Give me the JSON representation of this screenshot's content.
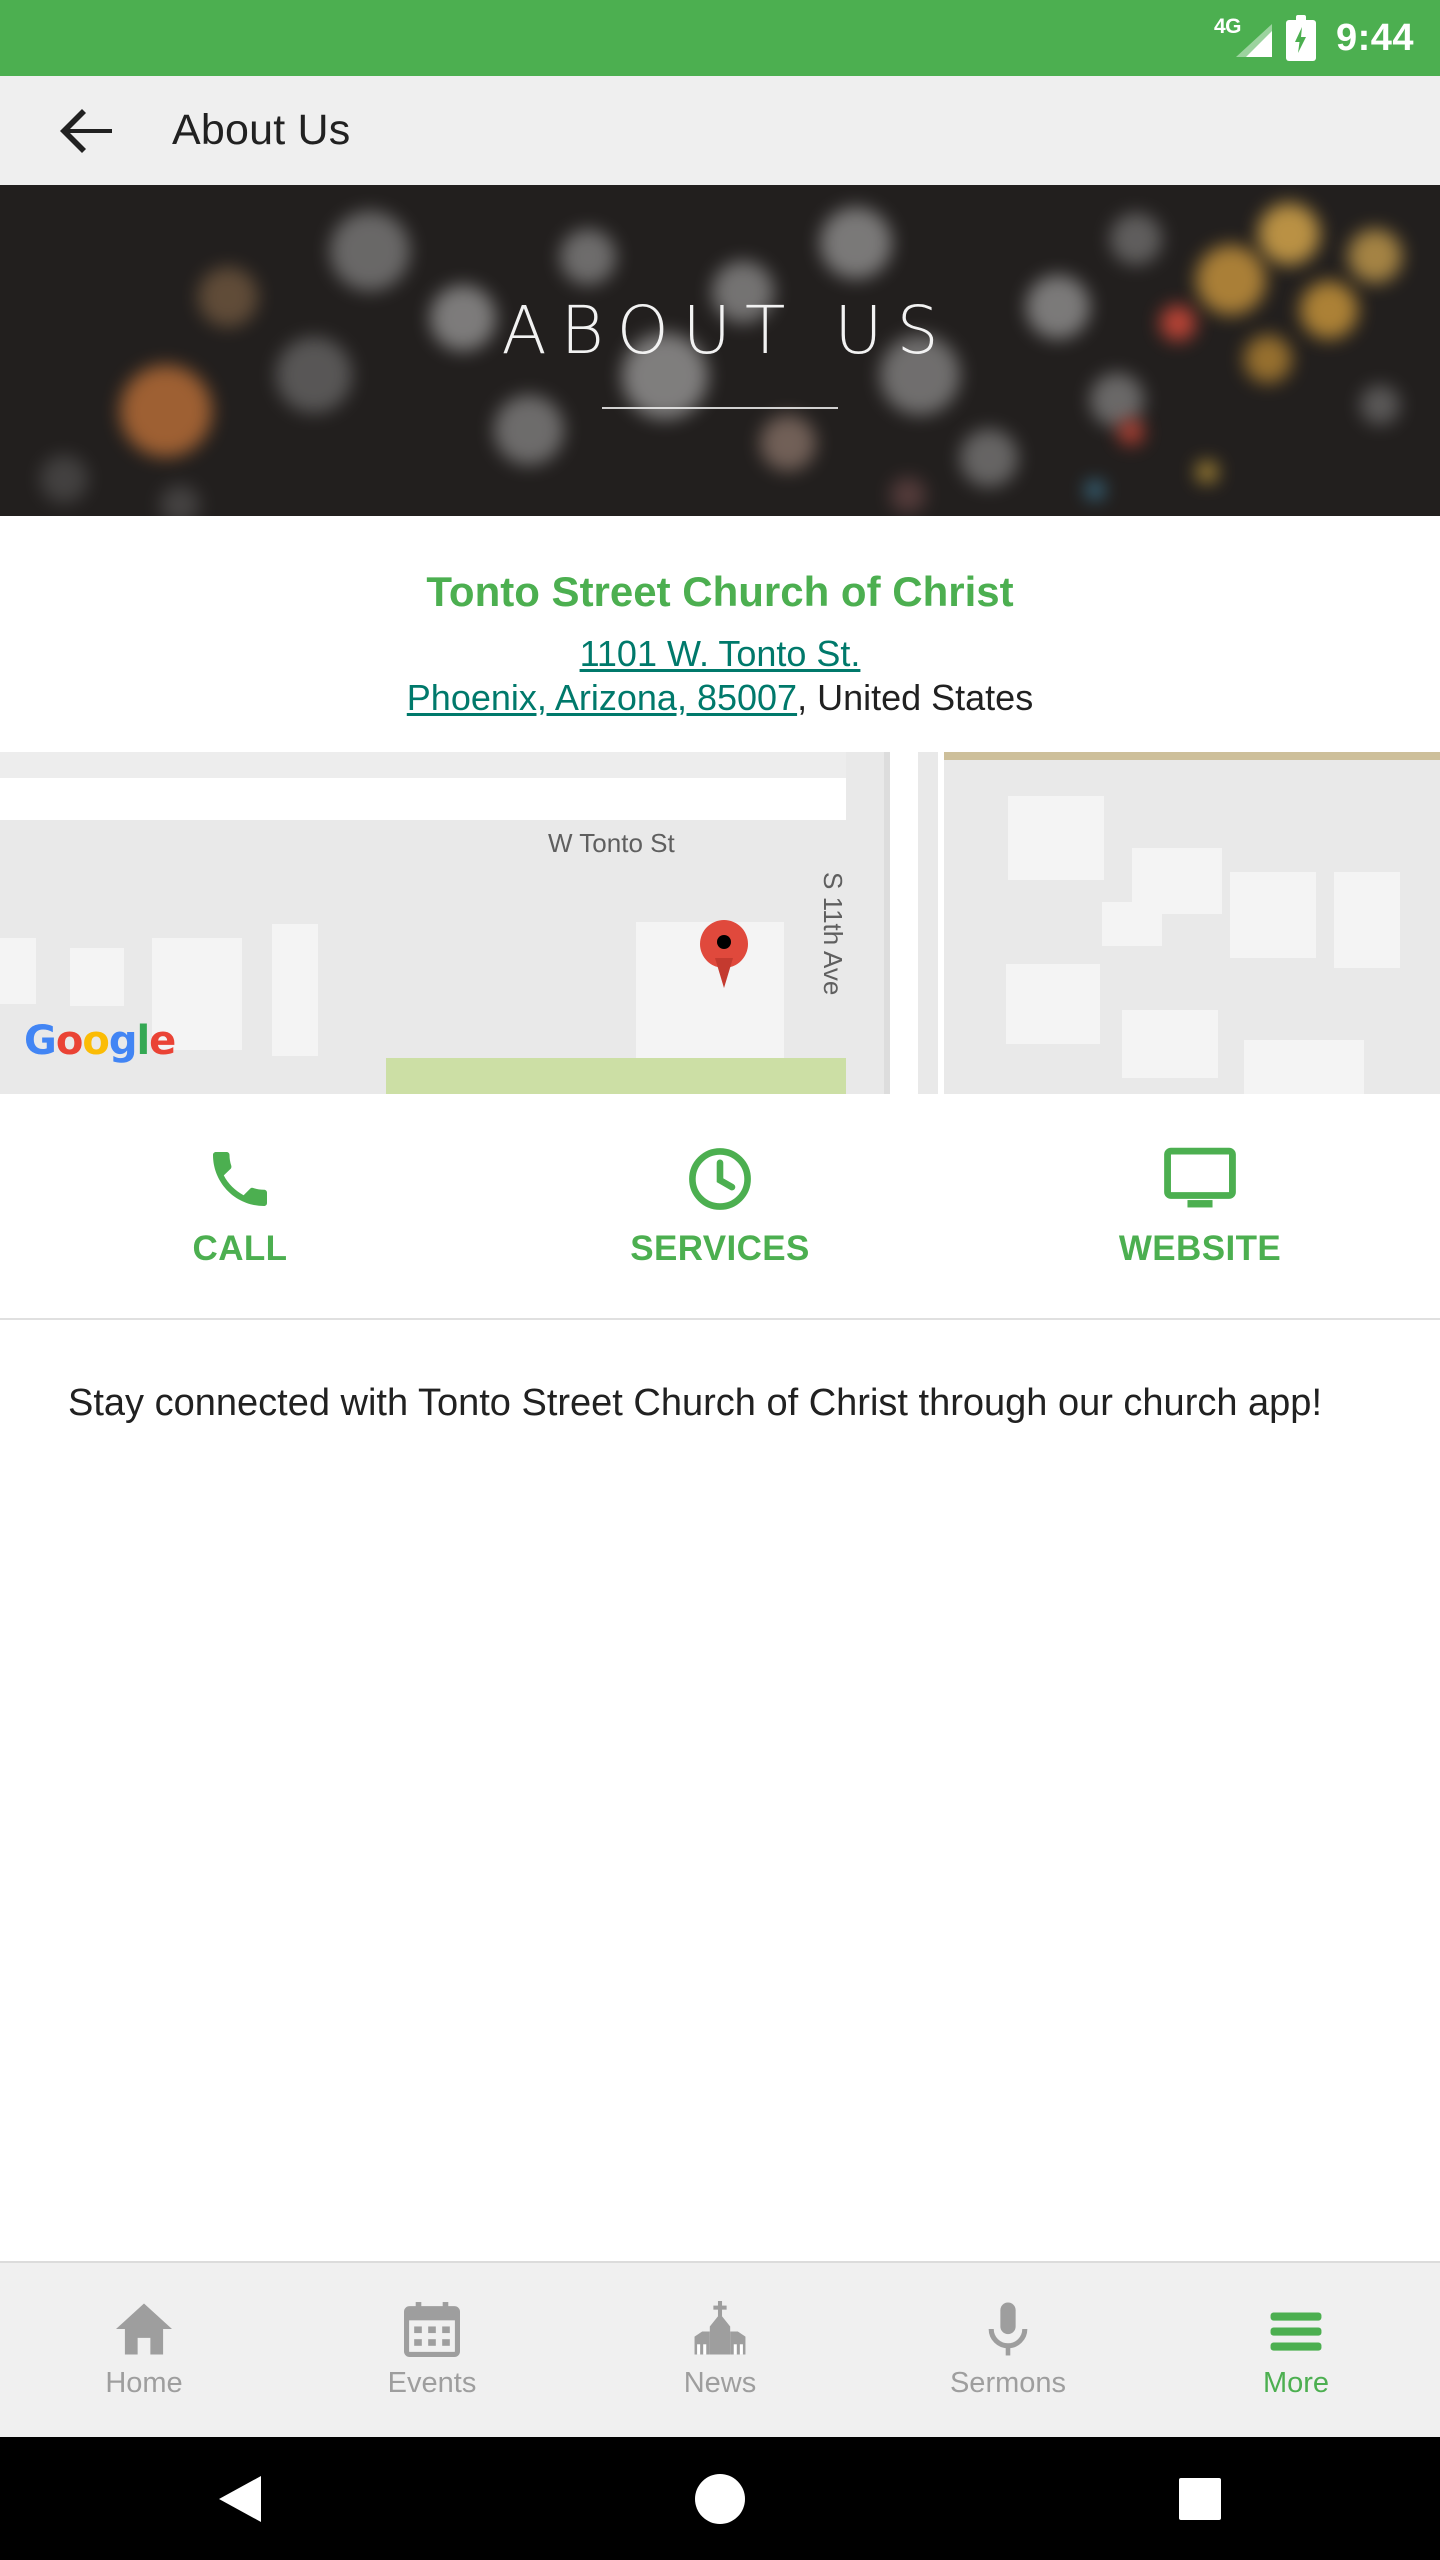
{
  "status_bar": {
    "network": "4G",
    "time": "9:44",
    "signal_icon": "signal-bars-icon",
    "battery_icon": "battery-charging-icon",
    "bg_color": "#4caf50"
  },
  "app_bar": {
    "back_icon": "back-arrow-icon",
    "title": "About Us"
  },
  "hero": {
    "title": "ABOUT US"
  },
  "info": {
    "church_name": "Tonto Street Church of Christ",
    "address_line1": "1101 W. Tonto St.",
    "address_line2": "Phoenix, Arizona, 85007",
    "address_country": ", United States"
  },
  "map": {
    "street_horizontal": "W Tonto St",
    "street_vertical": "S 11th Ave",
    "watermark": "Google",
    "marker_icon": "map-pin-icon"
  },
  "actions": [
    {
      "label": "CALL",
      "icon": "phone-icon"
    },
    {
      "label": "SERVICES",
      "icon": "clock-icon"
    },
    {
      "label": "WEBSITE",
      "icon": "monitor-icon"
    }
  ],
  "blurb": {
    "text": "Stay connected with Tonto Street Church of Christ through our church app!"
  },
  "bottom_nav": [
    {
      "label": "Home",
      "icon": "home-icon",
      "active": false
    },
    {
      "label": "Events",
      "icon": "calendar-icon",
      "active": false
    },
    {
      "label": "News",
      "icon": "church-icon",
      "active": false
    },
    {
      "label": "Sermons",
      "icon": "microphone-icon",
      "active": false
    },
    {
      "label": "More",
      "icon": "hamburger-icon",
      "active": true
    }
  ],
  "system_nav": {
    "back": "android-back-icon",
    "home": "android-home-icon",
    "recents": "android-recents-icon"
  },
  "colors": {
    "accent_green": "#4caf50",
    "link_teal": "#00796b",
    "appbar_bg": "#efefef",
    "nav_inactive": "#9e9e9e"
  }
}
